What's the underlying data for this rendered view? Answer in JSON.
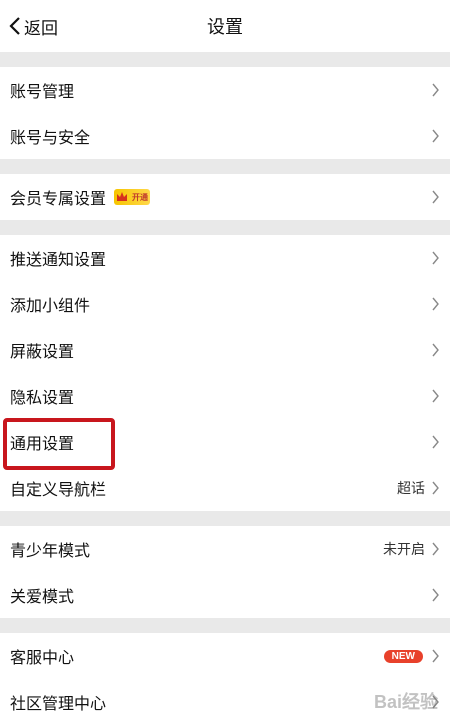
{
  "header": {
    "back_label": "返回",
    "title": "设置"
  },
  "sections": [
    {
      "items": [
        {
          "label": "账号管理"
        },
        {
          "label": "账号与安全"
        }
      ]
    },
    {
      "items": [
        {
          "label": "会员专属设置",
          "badge": "开通"
        }
      ]
    },
    {
      "items": [
        {
          "label": "推送通知设置"
        },
        {
          "label": "添加小组件"
        },
        {
          "label": "屏蔽设置"
        },
        {
          "label": "隐私设置"
        },
        {
          "label": "通用设置"
        },
        {
          "label": "自定义导航栏",
          "value": "超话"
        }
      ]
    },
    {
      "items": [
        {
          "label": "青少年模式",
          "value": "未开启"
        },
        {
          "label": "关爱模式"
        }
      ]
    },
    {
      "items": [
        {
          "label": "客服中心",
          "badge": "NEW"
        },
        {
          "label": "社区管理中心"
        }
      ]
    }
  ],
  "watermark": "Bai经验",
  "colors": {
    "highlight": "#c8161d",
    "new_badge": "#e8412b",
    "vip_badge": "#f6c500",
    "divider": "#e9e9e9"
  }
}
